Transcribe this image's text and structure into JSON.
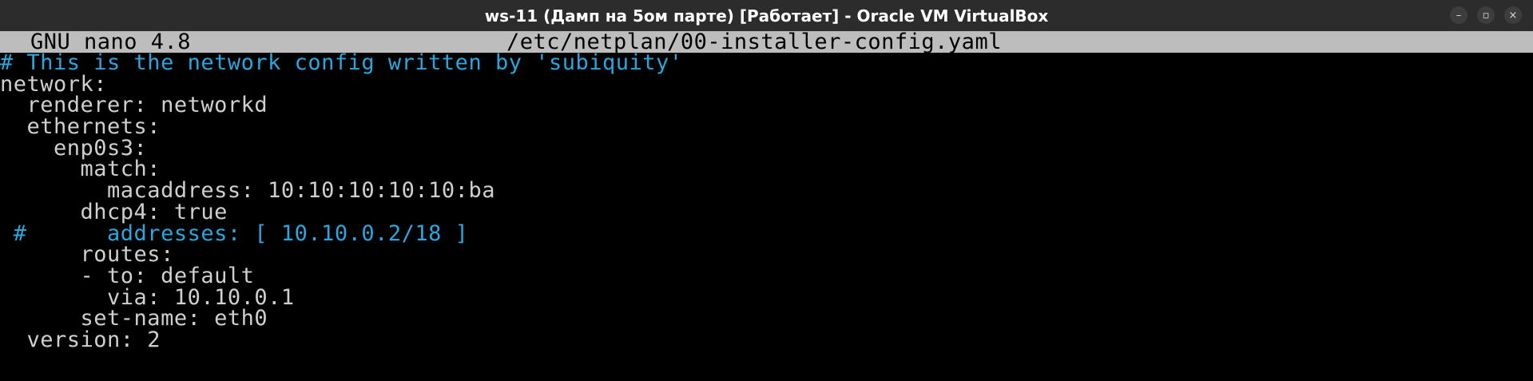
{
  "window": {
    "title": "ws-11 (Дамп на 5ом парте) [Работает] - Oracle VM VirtualBox",
    "controls": {
      "minimize_icon": "–",
      "maximize_icon": "▫",
      "close_icon": "×"
    }
  },
  "nano": {
    "version_label": "GNU nano 4.8",
    "file_name": "/etc/netplan/00-installer-config.yaml"
  },
  "lines": [
    {
      "text": "# This is the network config written by 'subiquity'",
      "kind": "comment"
    },
    {
      "text": "network:",
      "kind": "plain"
    },
    {
      "text": "  renderer: networkd",
      "kind": "plain"
    },
    {
      "text": "  ethernets:",
      "kind": "plain"
    },
    {
      "text": "    enp0s3:",
      "kind": "plain"
    },
    {
      "text": "      match:",
      "kind": "plain"
    },
    {
      "text": "        macaddress: 10:10:10:10:10:ba",
      "kind": "plain"
    },
    {
      "text": "      dhcp4: true",
      "kind": "plain"
    },
    {
      "text": " #      addresses: [ 10.10.0.2/18 ]",
      "kind": "comment"
    },
    {
      "text": "      routes:",
      "kind": "plain"
    },
    {
      "text": "      - to: default",
      "kind": "plain"
    },
    {
      "text": "        via: 10.10.0.1",
      "kind": "plain"
    },
    {
      "text": "      set-name: eth0",
      "kind": "plain"
    },
    {
      "text": "  version: 2",
      "kind": "plain"
    }
  ],
  "colors": {
    "titlebar": "#2c2c2c",
    "nano_header": "#bdbdbd",
    "comment": "#2aa6de",
    "text": "#cfcfcf",
    "background": "#000000"
  }
}
